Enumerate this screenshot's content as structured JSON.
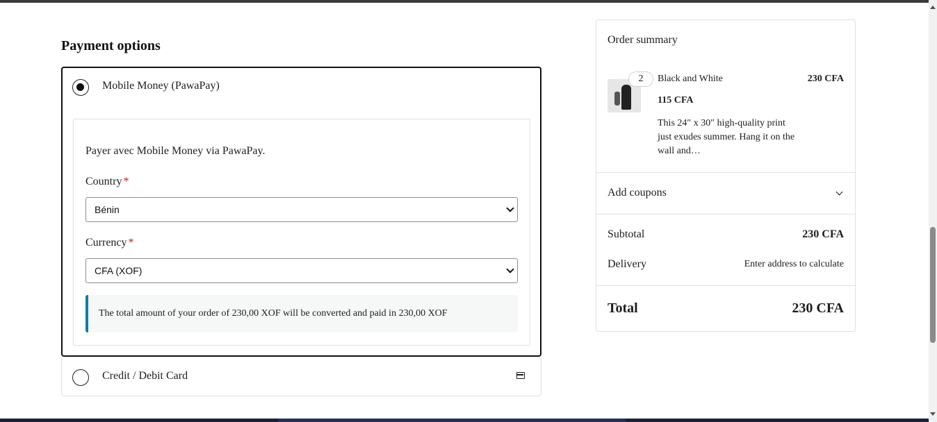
{
  "payment": {
    "title": "Payment options",
    "methods": [
      {
        "label": "Mobile Money (PawaPay)",
        "selected": true,
        "description": "Payer avec Mobile Money via PawaPay.",
        "country_label": "Country",
        "country_value": "Bénin",
        "currency_label": "Currency",
        "currency_value": "CFA (XOF)",
        "required_marker": "*",
        "notice": "The total amount of your order of 230,00 XOF will be converted and paid in 230,00 XOF"
      },
      {
        "label": "Credit / Debit Card",
        "selected": false,
        "icon": "credit-card-icon"
      }
    ]
  },
  "summary": {
    "title": "Order summary",
    "item": {
      "quantity": "2",
      "name": "Black and White",
      "total": "230 CFA",
      "unit_price": "115 CFA",
      "description": "This 24″ x 30″ high-quality print just exudes summer. Hang it on the wall and…"
    },
    "coupons_label": "Add coupons",
    "subtotal_label": "Subtotal",
    "subtotal_value": "230 CFA",
    "delivery_label": "Delivery",
    "delivery_value": "Enter address to calculate",
    "total_label": "Total",
    "total_value": "230 CFA"
  },
  "colors": {
    "accent_notice": "#0a7ea8",
    "required": "#cc1818"
  }
}
